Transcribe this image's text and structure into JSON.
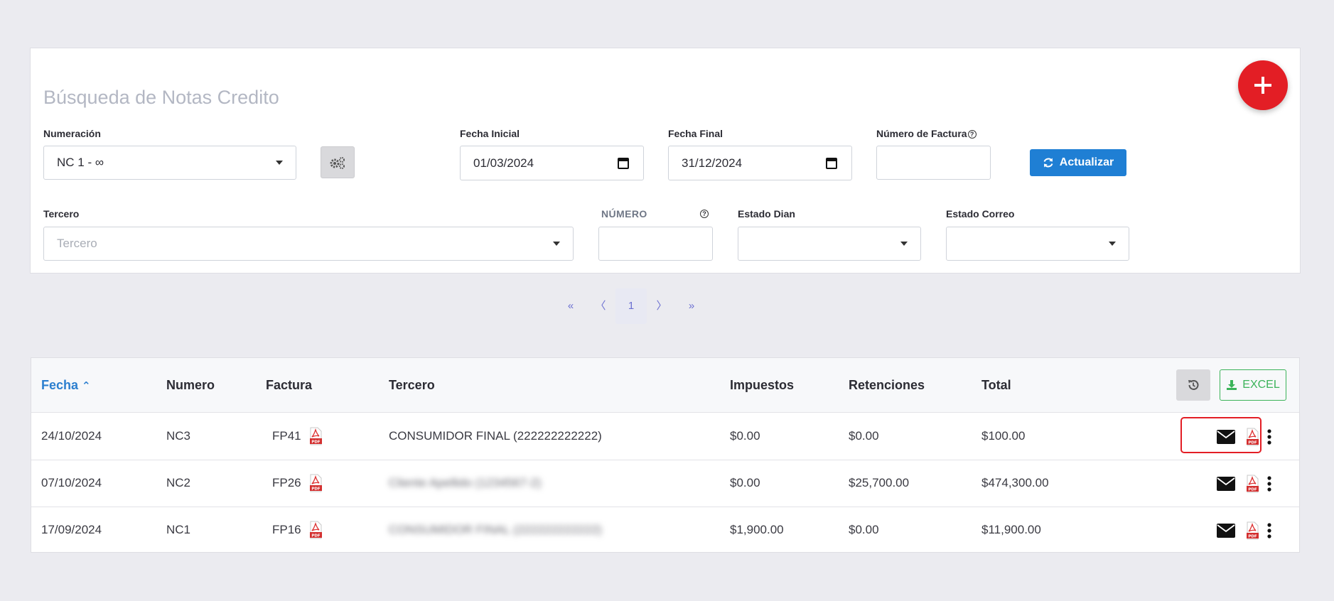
{
  "search": {
    "title": "Búsqueda de Notas Credito",
    "numeracion": {
      "label": "Numeración",
      "value": "NC 1 - ∞"
    },
    "fecha_inicial": {
      "label": "Fecha Inicial",
      "value": "01/03/2024"
    },
    "fecha_final": {
      "label": "Fecha Final",
      "value": "31/12/2024"
    },
    "numero_factura": {
      "label": "Número de Factura",
      "value": ""
    },
    "actualizar_label": "Actualizar",
    "tercero": {
      "label": "Tercero",
      "placeholder": "Tercero"
    },
    "numero": {
      "label": "NÚMERO",
      "value": ""
    },
    "estado_dian": {
      "label": "Estado Dian",
      "value": ""
    },
    "estado_correo": {
      "label": "Estado Correo",
      "value": ""
    }
  },
  "pagination": {
    "first": "«",
    "prev": "〈",
    "current": "1",
    "next": "〉",
    "last": "»"
  },
  "table": {
    "columns": [
      "Fecha",
      "Numero",
      "Factura",
      "Tercero",
      "Impuestos",
      "Retenciones",
      "Total"
    ],
    "sort_indicator": "⌃",
    "excel_label": "EXCEL",
    "rows": [
      {
        "fecha": "24/10/2024",
        "numero": "NC3",
        "factura": "FP41",
        "tercero": "CONSUMIDOR FINAL (222222222222)",
        "impuestos": "$0.00",
        "retenciones": "$0.00",
        "total": "$100.00"
      },
      {
        "fecha": "07/10/2024",
        "numero": "NC2",
        "factura": "FP26",
        "tercero": "Cliente Apellido (1234567-2)",
        "impuestos": "$0.00",
        "retenciones": "$25,700.00",
        "total": "$474,300.00"
      },
      {
        "fecha": "17/09/2024",
        "numero": "NC1",
        "factura": "FP16",
        "tercero": "CONSUMIDOR FINAL (222222222222)",
        "impuestos": "$1,900.00",
        "retenciones": "$0.00",
        "total": "$11,900.00"
      }
    ]
  },
  "colors": {
    "accent_red": "#e31e25",
    "primary_blue": "#1f7fd4",
    "excel_green": "#3cb35a",
    "pager_purple": "#6b6fd1"
  },
  "icons": [
    "plus-icon",
    "gears-icon",
    "calendar-icon",
    "refresh-icon",
    "help-icon",
    "history-icon",
    "download-icon",
    "pdf-icon",
    "mail-icon",
    "more-vertical-icon"
  ]
}
